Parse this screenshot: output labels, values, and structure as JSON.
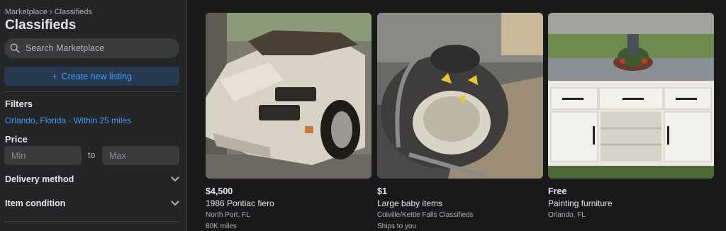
{
  "sidebar": {
    "breadcrumb": "Marketplace › Classifieds",
    "title": "Classifieds",
    "search_placeholder": "Search Marketplace",
    "create_label": "Create new listing",
    "filters_heading": "Filters",
    "location": "Orlando, Florida · Within 25 miles",
    "price_heading": "Price",
    "min_placeholder": "Min",
    "to_label": "to",
    "max_placeholder": "Max",
    "delivery_label": "Delivery method",
    "condition_label": "Item condition"
  },
  "listings": [
    {
      "price": "$4,500",
      "title": "1986 Pontiac fiero",
      "location": "North Port, FL",
      "extra": "80K miles"
    },
    {
      "price": "$1",
      "title": "Large baby items",
      "location": "Colville/Kettle Falls Classifieds",
      "extra": "Ships to you"
    },
    {
      "price": "Free",
      "title": "Painting furniture",
      "location": "Orlando, FL",
      "extra": ""
    }
  ],
  "colors": {
    "accent": "#4599ff",
    "background": "#18191a",
    "panel": "#242526"
  }
}
